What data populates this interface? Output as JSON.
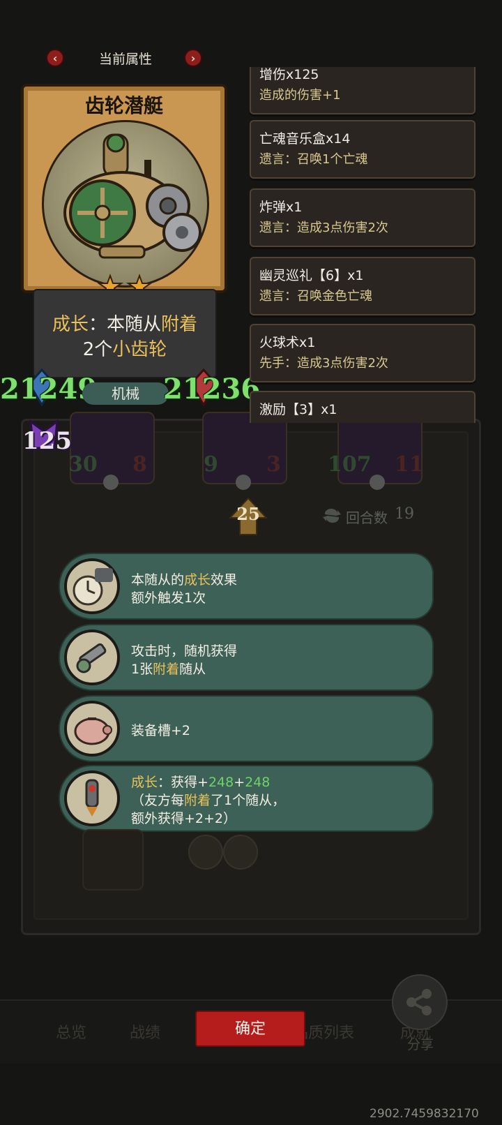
{
  "header": {
    "title": "当前属性",
    "prev_icon": "‹",
    "next_icon": "›"
  },
  "card": {
    "name": "齿轮潜艇",
    "stars": 2,
    "description": {
      "line1": {
        "prefix": "成长",
        "sep": "：本随从",
        "keyword": "附着"
      },
      "line2": {
        "count": "2个",
        "keyword": "小齿轮"
      }
    },
    "attack": "21249",
    "tribe": "机械",
    "health": "21236",
    "damage_bonus": "125"
  },
  "keywords": [
    {
      "name": "增伤x125",
      "desc": "造成的伤害+1"
    },
    {
      "name": "亡魂音乐盒x14",
      "desc": "遗言：召唤1个亡魂"
    },
    {
      "name": "炸弹x1",
      "desc": "遗言：造成3点伤害2次"
    },
    {
      "name": "幽灵巡礼【6】x1",
      "desc": "遗言：召唤金色亡魂"
    },
    {
      "name": "火球术x1",
      "desc": "先手：造成3点伤害2次"
    },
    {
      "name": "激励【3】x1",
      "desc": ""
    }
  ],
  "board": {
    "minions": [
      {
        "attack": "30",
        "health": "8"
      },
      {
        "attack": "9",
        "health": "3"
      },
      {
        "attack": "107",
        "health": "11"
      }
    ],
    "upgrade_level": "25",
    "round_label": "回合数",
    "round_value": "19"
  },
  "equipment": [
    {
      "icon": "pocket-watch-icon",
      "line1_pre": "本随从的",
      "line1_kw": "成长",
      "line1_post": "效果",
      "line2": "额外触发1次"
    },
    {
      "icon": "mech-arm-icon",
      "line1": "攻击时，随机获得",
      "line2_pre": "1张",
      "line2_kw": "附着",
      "line2_post": "随从"
    },
    {
      "icon": "piggy-bank-icon",
      "line1": "装备槽+2"
    },
    {
      "icon": "rocket-gear-icon",
      "line1_kw": "成长",
      "line1_mid": "：获得+",
      "line1_n1": "248",
      "line1_plus": "+",
      "line1_n2": "248",
      "line2_pre": "（友方每",
      "line2_kw": "附着",
      "line2_post": "了1个随从，",
      "line3": "额外获得+2+2）"
    }
  ],
  "bottom": {
    "tabs": [
      "总览",
      "战绩",
      "品质列表",
      "成就"
    ],
    "confirm_label": "确定",
    "share_label": "分享",
    "coords": "2902.7459832170"
  },
  "colors": {
    "accent_gold": "#e9c25c",
    "accent_green": "#6ed26a",
    "confirm_red": "#b51d1d",
    "panel_teal": "#3e6157"
  }
}
